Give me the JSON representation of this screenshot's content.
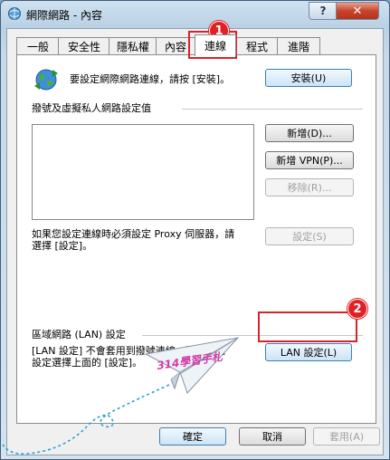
{
  "window": {
    "title": "網際網路 - 內容",
    "help_label": "?",
    "close_label": "✕"
  },
  "tabs": [
    {
      "label": "一般",
      "active": false
    },
    {
      "label": "安全性",
      "active": false
    },
    {
      "label": "隱私權",
      "active": false
    },
    {
      "label": "內容",
      "active": false
    },
    {
      "label": "連線",
      "active": true
    },
    {
      "label": "程式",
      "active": false
    },
    {
      "label": "進階",
      "active": false
    }
  ],
  "setup": {
    "text": "要設定網際網路連線，請按 [安裝]。",
    "button": "安裝(U)"
  },
  "dialup": {
    "heading": "撥號及虛擬私人網路設定值",
    "add_button": "新增(D)...",
    "add_vpn_button": "新增 VPN(P)...",
    "remove_button": "移除(R)...",
    "settings_button": "設定(S)",
    "proxy_text_line1": "如果您設定連線時必須設定 Proxy 伺服器，請",
    "proxy_text_line2": "選擇 [設定]。"
  },
  "lan": {
    "heading": "區域網路 (LAN) 設定",
    "text_line1": "[LAN 設定] 不會套用到撥號連線。請為撥號",
    "text_line2": "設定選擇上面的 [設定]。",
    "button": "LAN 設定(L)"
  },
  "footer": {
    "ok": "確定",
    "cancel": "取消",
    "apply": "套用(A)"
  },
  "annotations": {
    "badge1": "1",
    "badge2": "2",
    "watermark": "314學習手札",
    "accent": "#d9232a"
  }
}
